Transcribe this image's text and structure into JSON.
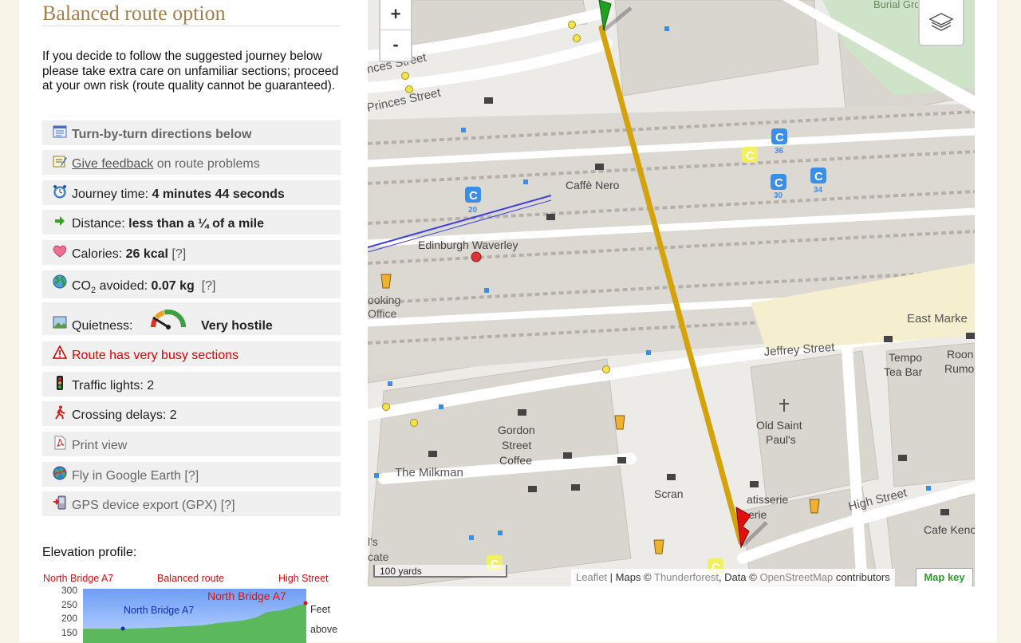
{
  "title": "Balanced route option",
  "intro": "If you decide to follow the suggested journey below please take extra care on unfamiliar sections; proceed at your own risk (route quality cannot be guaranteed).",
  "rows": {
    "directions": "Turn-by-turn directions below",
    "feedback_link": "Give feedback",
    "feedback_rest": " on route problems",
    "journey_label": "Journey time: ",
    "journey_value": "4 minutes 44 seconds",
    "distance_label": "Distance: ",
    "distance_value": "less than a ¼ of a mile",
    "calories_label": "Calories: ",
    "calories_value": "26 kcal",
    "help": "[?]",
    "co2_prefix": "CO",
    "co2_sub": "2",
    "co2_label": " avoided: ",
    "co2_value": "0.07 kg",
    "quietness_label": "Quietness:",
    "quietness_value": "Very hostile",
    "busy": "Route has very busy sections",
    "traffic": "Traffic lights: 2",
    "crossing": "Crossing delays: 2",
    "print": "Print view",
    "earth": "Fly in Google Earth [?]",
    "gpx": "GPS device export (GPX) [?]"
  },
  "elevation": {
    "label": "Elevation profile:",
    "header_left": "North Bridge  A7",
    "header_mid": "Balanced route",
    "header_right": "High Street",
    "marker_label": "North Bridge  A7",
    "inside_label": "North Bridge  A7",
    "unit_1": "Feet",
    "unit_2": "above",
    "y_ticks": [
      "300",
      "250",
      "200",
      "150"
    ]
  },
  "map": {
    "zoom_in": "+",
    "zoom_out": "-",
    "scale": "100 yards",
    "leaflet": "Leaflet",
    "maps_by": " | Maps © ",
    "thunderforest": "Thunderforest",
    "data_by": ", Data © ",
    "osm": "OpenStreetMap",
    "contributors": " contributors",
    "map_key": "Map key",
    "labels": {
      "princes1": "nces Street",
      "princes2": "Princes Street",
      "caffe": "Caffè Nero",
      "waverley": "Edinburgh Waverley",
      "booking1": "ooking",
      "booking2": "Office",
      "eastmarket": "East Marke",
      "jeffrey": "Jeffrey Street",
      "tempo1": "Tempo",
      "tempo2": "Tea Bar",
      "room1": "Roon",
      "room2": "Rumo",
      "oldsaint1": "Old Saint",
      "oldsaint2": "Paul's",
      "gordon1": "Gordon",
      "gordon2": "Street",
      "gordon3": "Coffee",
      "milkman": "The Milkman",
      "scran": "Scran",
      "patisserie1": "atisserie",
      "patisserie2": "erie",
      "highstreet": "High Street",
      "cafekeno": "Cafe Keno",
      "ils": "l's",
      "cate": "cate",
      "burial": "Burial Groun",
      "stop20": "20",
      "stop36": "36",
      "stop30": "30",
      "stop34": "34",
      "c": "C"
    }
  },
  "colors": {
    "title": "#a08050",
    "route": "#d4a20a",
    "busy": "#e00000",
    "mapkey": "#2a9a2a"
  }
}
